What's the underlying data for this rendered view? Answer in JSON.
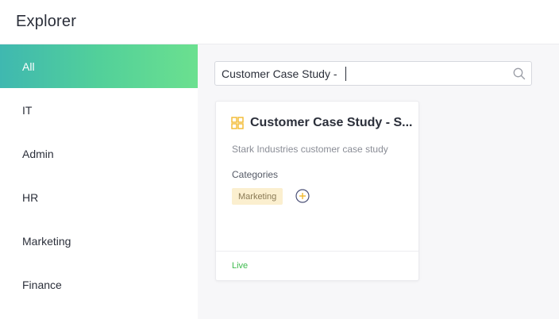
{
  "header": {
    "title": "Explorer"
  },
  "sidebar": {
    "items": [
      {
        "label": "All",
        "active": true
      },
      {
        "label": "IT"
      },
      {
        "label": "Admin"
      },
      {
        "label": "HR"
      },
      {
        "label": "Marketing"
      },
      {
        "label": "Finance"
      }
    ]
  },
  "search": {
    "value": "Customer Case Study - ",
    "icon": "search-icon"
  },
  "card": {
    "icon": "grid-icon",
    "title": "Customer Case Study - S...",
    "description": "Stark Industries customer case study",
    "categories_label": "Categories",
    "tags": [
      "Marketing"
    ],
    "add_icon": "add-circle-icon",
    "status": "Live"
  },
  "colors": {
    "accent_gradient_start": "#3fb8b0",
    "accent_gradient_end": "#6be08f",
    "tag_bg": "#fbefcf",
    "status_green": "#3dbb4d",
    "icon_yellow": "#f2b92e"
  }
}
